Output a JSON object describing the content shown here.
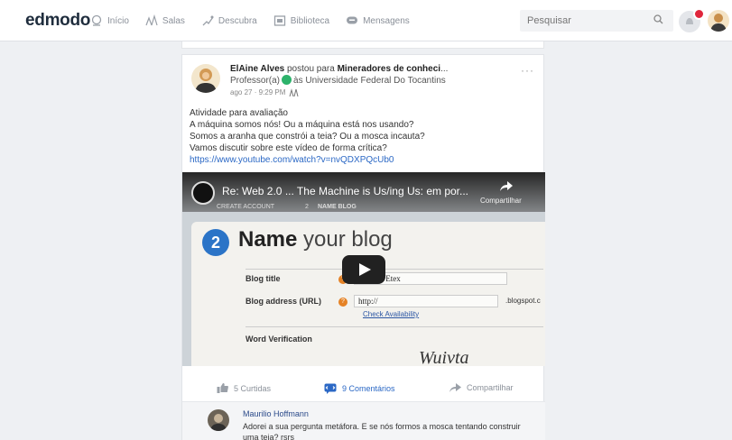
{
  "app": {
    "logo": "edmodo",
    "nav": [
      {
        "label": "Início",
        "icon": "home-icon"
      },
      {
        "label": "Salas",
        "icon": "classes-icon"
      },
      {
        "label": "Descubra",
        "icon": "discover-icon"
      },
      {
        "label": "Biblioteca",
        "icon": "library-icon"
      },
      {
        "label": "Mensagens",
        "icon": "messages-icon"
      }
    ],
    "search": {
      "placeholder": "Pesquisar"
    },
    "colors": {
      "accent": "#2b68c5",
      "badge": "#e0263c",
      "verified": "#2db36b"
    }
  },
  "post": {
    "author": "ElAine Alves",
    "action": " postou para ",
    "group": "Mineradores de conheci",
    "group_ellipsis": "...",
    "role": "Professor(a)",
    "institution": "às Universidade Federal Do Tocantins",
    "timestamp": "ago 27 · 9:29 PM",
    "more": "···",
    "lines": [
      "Atividade para avaliação",
      "A máquina somos nós! Ou a máquina está nos usando?",
      "Somos a aranha que constrói a teia? Ou a mosca incauta?",
      "Vamos discutir sobre este vídeo de forma crítica?"
    ],
    "link": "https://www.youtube.com/watch?v=nvQDXPQcUb0"
  },
  "video": {
    "title": "Re: Web 2.0 ... The Machine is Us/ing Us: em por...",
    "share": "Compartilhar",
    "steps": [
      "CREATE ACCOUNT",
      "2",
      "NAME BLOG"
    ],
    "step_number": "2",
    "heading_bold": "Name",
    "heading_rest": " your blog",
    "blog_title_label": "Blog title",
    "blog_title_value": "Beyond Etex",
    "blog_address_label": "Blog address (URL)",
    "blog_address_value": "http://",
    "blog_address_suffix": ".blogspot.c",
    "check_availability": "Check Availability",
    "word_verification": "Word Verification",
    "captcha": "Wuivta"
  },
  "actions": {
    "likes": "5 Curtidas",
    "comments": "9 Comentários",
    "share": "Compartilhar"
  },
  "comment": {
    "author": "Maurilio Hoffmann",
    "text": "Adorei a sua pergunta metáfora. E se nós formos a mosca tentando construir uma teia? rsrs"
  }
}
